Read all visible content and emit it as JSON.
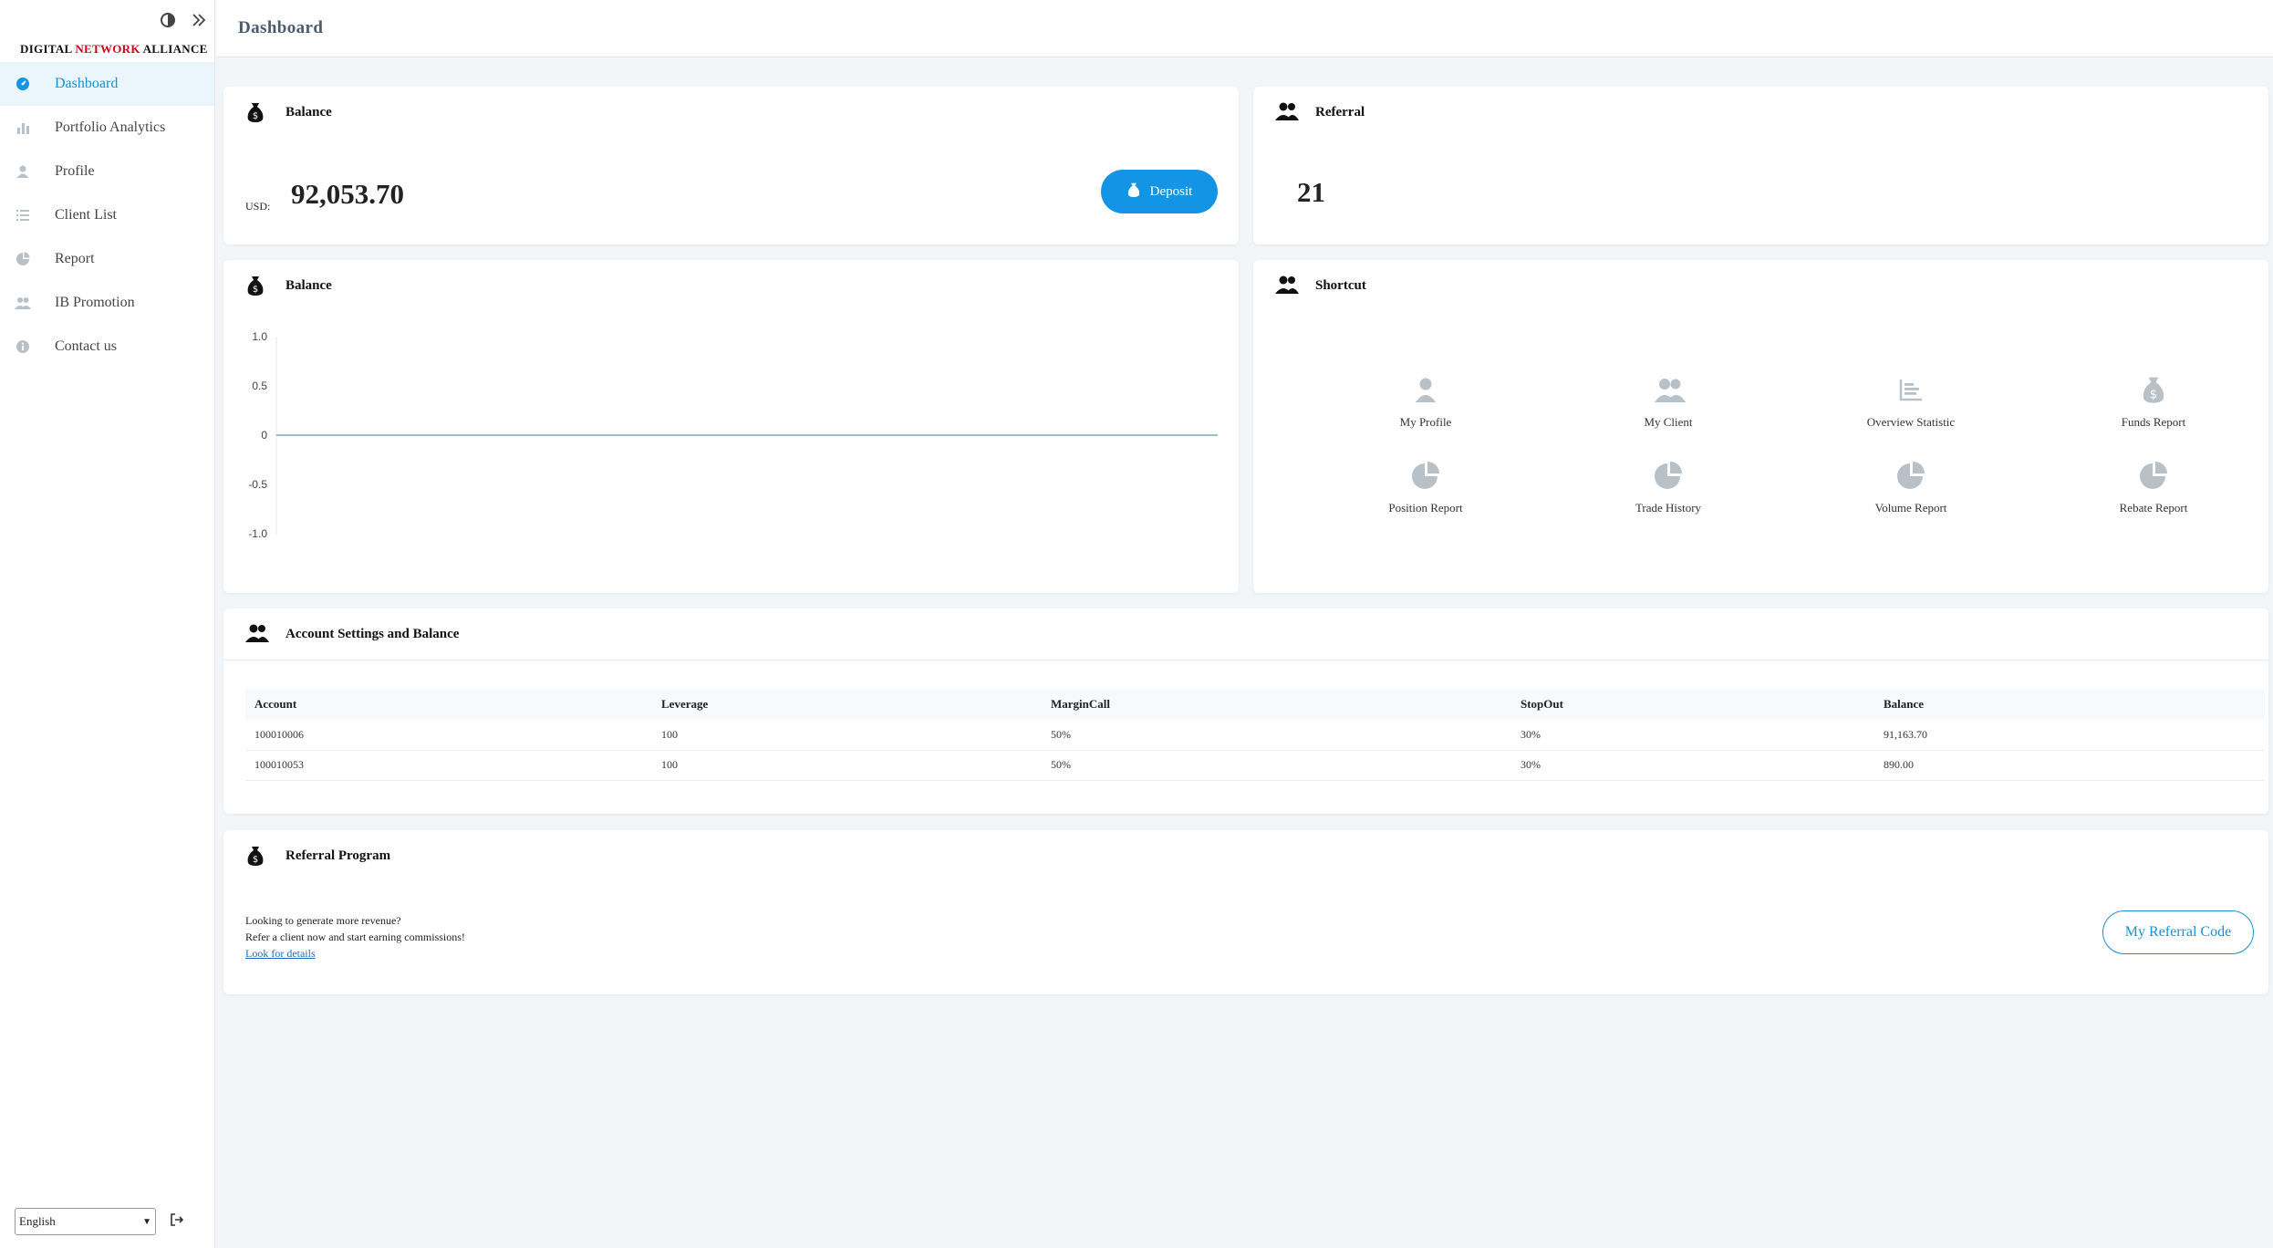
{
  "brand": {
    "part1": "DIGITAL ",
    "part2": "NETWORK",
    "part3": " ALLIANCE"
  },
  "sidebar": {
    "items": [
      {
        "label": "Dashboard",
        "icon": "dashboard-icon",
        "active": true
      },
      {
        "label": "Portfolio Analytics",
        "icon": "bar-chart-icon"
      },
      {
        "label": "Profile",
        "icon": "user-icon"
      },
      {
        "label": "Client List",
        "icon": "list-icon"
      },
      {
        "label": "Report",
        "icon": "pie-chart-icon"
      },
      {
        "label": "IB Promotion",
        "icon": "users-icon"
      },
      {
        "label": "Contact us",
        "icon": "info-icon"
      }
    ],
    "language": "English"
  },
  "header": {
    "title": "Dashboard"
  },
  "balance_card": {
    "title": "Balance",
    "currency": "USD:",
    "amount": "92,053.70",
    "deposit_label": "Deposit"
  },
  "referral_card": {
    "title": "Referral",
    "count": "21"
  },
  "balance_chart_card": {
    "title": "Balance",
    "chart_data": {
      "type": "line",
      "series": [
        {
          "values": [
            0,
            0
          ]
        }
      ],
      "yticks": [
        "1.0",
        "0.5",
        "0",
        "-0.5",
        "-1.0"
      ],
      "ylim": [
        -1,
        1
      ],
      "line_color": "#5b9bb5"
    }
  },
  "shortcut_card": {
    "title": "Shortcut",
    "items": [
      {
        "label": "My Profile",
        "icon": "user-icon"
      },
      {
        "label": "My Client",
        "icon": "users-icon"
      },
      {
        "label": "Overview Statistic",
        "icon": "bar-chart-icon"
      },
      {
        "label": "Funds Report",
        "icon": "money-bag-icon"
      },
      {
        "label": "Position Report",
        "icon": "pie-chart-icon"
      },
      {
        "label": "Trade History",
        "icon": "pie-chart-icon"
      },
      {
        "label": "Volume Report",
        "icon": "pie-chart-icon"
      },
      {
        "label": "Rebate Report",
        "icon": "pie-chart-icon"
      }
    ]
  },
  "account_card": {
    "title": "Account Settings and Balance",
    "columns": [
      "Account",
      "Leverage",
      "MarginCall",
      "StopOut",
      "Balance"
    ],
    "rows": [
      [
        "100010006",
        "100",
        "50%",
        "30%",
        "91,163.70"
      ],
      [
        "100010053",
        "100",
        "50%",
        "30%",
        "890.00"
      ]
    ]
  },
  "referral_program": {
    "title": "Referral Program",
    "line1": "Looking to generate more revenue?",
    "line2": "Refer a client now and start earning commissions!",
    "link": "Look for details",
    "button": "My Referral Code"
  },
  "colors": {
    "accent": "#1494e4",
    "active_bg": "#eaf5fc",
    "icon_gray": "#b8c0c8"
  }
}
